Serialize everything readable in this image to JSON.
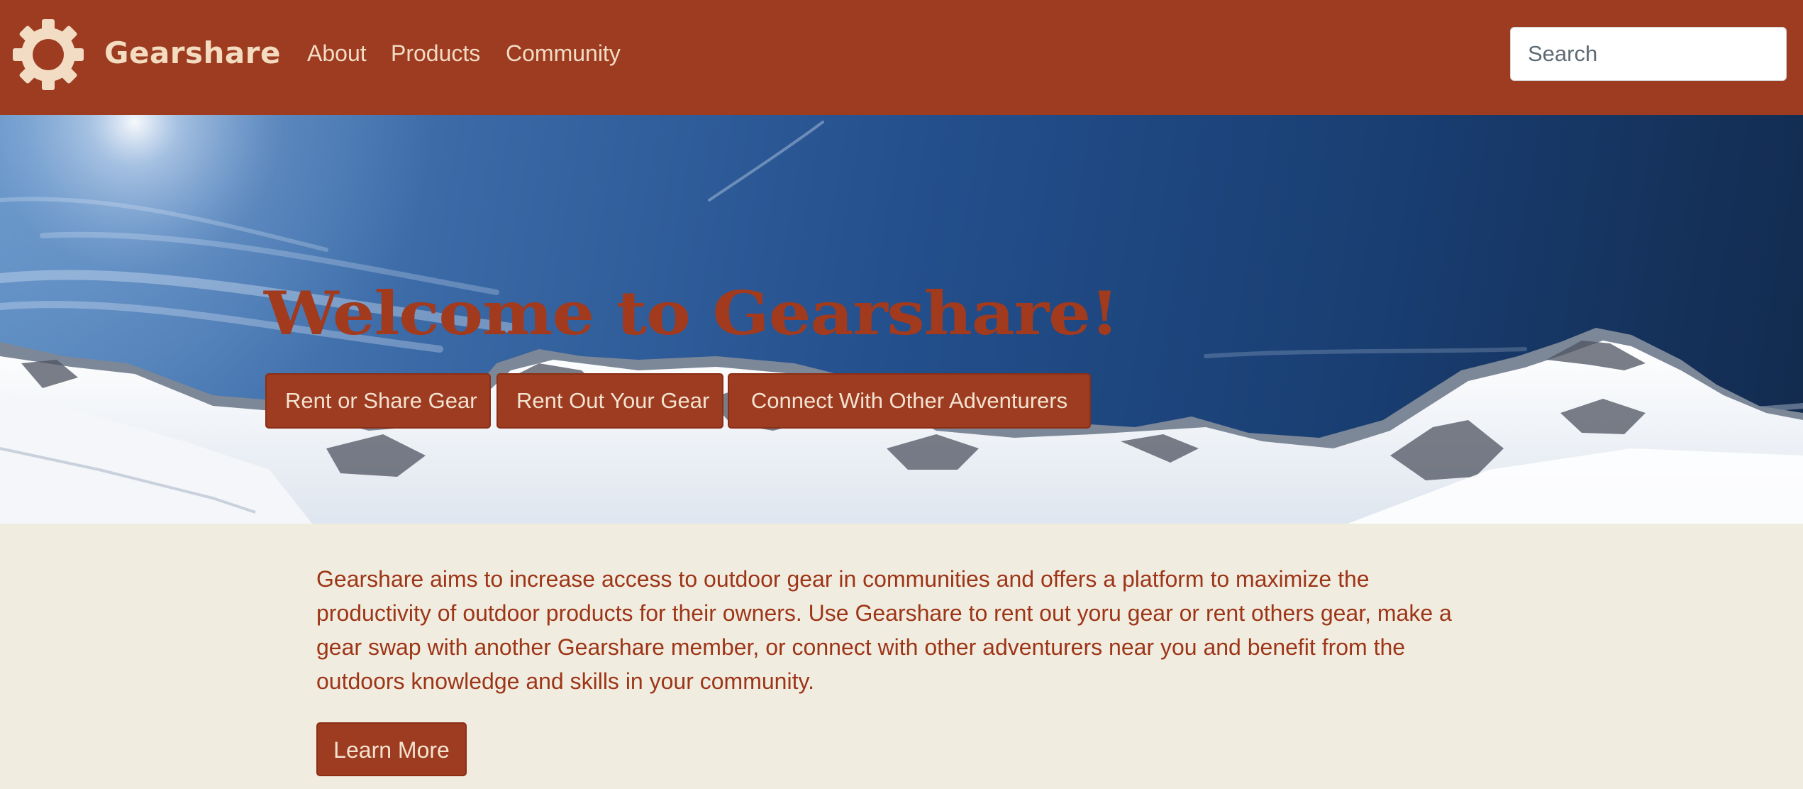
{
  "navbar": {
    "brand": "Gearshare",
    "logo_icon": "gear-icon",
    "links": [
      {
        "label": "About"
      },
      {
        "label": "Products"
      },
      {
        "label": "Community"
      }
    ],
    "search_placeholder": "Search",
    "background_color": "#9d3c21"
  },
  "hero": {
    "title": "Welcome to Gearshare!",
    "buttons": [
      {
        "label": "Rent or Share Gear"
      },
      {
        "label": "Rent Out Your Gear"
      },
      {
        "label": "Connect With Other Adventurers"
      }
    ],
    "background_image": "snowy-mountains-under-blue-sky"
  },
  "intro": {
    "text": "Gearshare aims to increase access to outdoor gear in communities and offers a platform to maximize the productivity of outdoor products for their owners. Use Gearshare to rent out yoru gear or rent others gear, make a gear swap with another Gearshare member, or connect with other adventurers near you and benefit from the outdoors knowledge and skills in your community.",
    "button_label": "Learn More"
  },
  "colors": {
    "accent": "#9d3c21",
    "page_background": "#f1ece0",
    "accent_text": "#f4dcc0"
  }
}
